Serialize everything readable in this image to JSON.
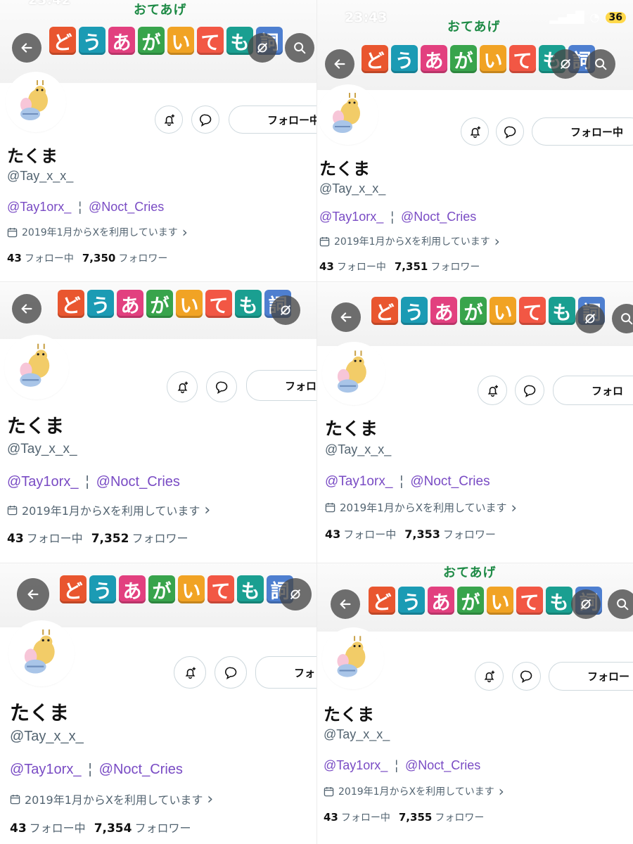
{
  "banner": {
    "subtitle": "おてあげ",
    "tiles": [
      {
        "char": "ど",
        "color": "#e9562f"
      },
      {
        "char": "う",
        "color": "#1b9bb4"
      },
      {
        "char": "あ",
        "color": "#e2407f"
      },
      {
        "char": "が",
        "color": "#38a44c"
      },
      {
        "char": "い",
        "color": "#f1a324"
      },
      {
        "char": "て",
        "color": "#f25744"
      },
      {
        "char": "も",
        "color": "#1a9f91"
      },
      {
        "char": "詞",
        "color": "#4e7fd0"
      }
    ]
  },
  "status_bar": {
    "time_left": "23:42",
    "time_right": "23:43",
    "battery": "36"
  },
  "profile": {
    "display_name": "たくま",
    "handle": "@Tay_x_x_",
    "linked_accounts": [
      "@Tay1orx_",
      "@Noct_Cries"
    ],
    "separator": "¦",
    "joined": "2019年1月からXを利用しています",
    "joined_chevron": "›",
    "following_count": "43",
    "following_label": "フォロー中",
    "followers_label": "フォロワー",
    "follow_button_label": "フォロー中"
  },
  "panels": [
    {
      "id": "p1",
      "followers_count": "7,350",
      "follow_label": "フォロー中"
    },
    {
      "id": "p2",
      "followers_count": "7,351",
      "follow_label": "フォロー中"
    },
    {
      "id": "p3",
      "followers_count": "7,352",
      "follow_label": "フォロ"
    },
    {
      "id": "p4",
      "followers_count": "7,353",
      "follow_label": "フォロ"
    },
    {
      "id": "p5",
      "followers_count": "7,354",
      "follow_label": "フォ"
    },
    {
      "id": "p6",
      "followers_count": "7,355",
      "follow_label": "フォロー"
    }
  ],
  "icons": {
    "back": "arrow-left-icon",
    "hide_media": "eye-off-icon",
    "search": "search-icon",
    "notify": "bell-plus-icon",
    "message": "message-icon",
    "calendar": "calendar-icon"
  },
  "colors": {
    "link": "#794bc4",
    "muted": "#536471",
    "text": "#111111",
    "border": "#cfd9de"
  }
}
